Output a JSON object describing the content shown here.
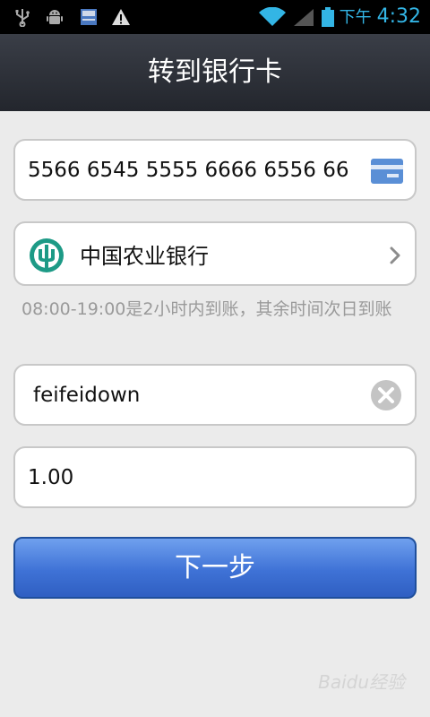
{
  "status_bar": {
    "ampm": "下午",
    "time": "4:32",
    "icons": [
      "usb-icon",
      "android-debug-icon",
      "sd-card-icon",
      "warning-icon",
      "wifi-icon",
      "signal-icon",
      "battery-icon"
    ]
  },
  "header": {
    "title": "转到银行卡"
  },
  "card_number": {
    "value": "5566 6545 5555 6666 6556 66",
    "icon": "bank-card-icon"
  },
  "bank": {
    "name": "中国农业银行",
    "logo": "abc-bank-logo-icon",
    "chevron": "chevron-right-icon"
  },
  "arrival_note": "08:00-19:00是2小时内到账，其余时间次日到账",
  "payee_name": {
    "value": "feifeidown",
    "clear_icon": "clear-icon"
  },
  "amount": {
    "value": "1.00"
  },
  "next_button": {
    "label": "下一步"
  },
  "watermark": {
    "text": "Baidu经验"
  },
  "colors": {
    "title_bar": "#2e3139",
    "button": "#4a7fe0",
    "clock": "#33b5e5",
    "bank_logo": "#1d9a86",
    "card_icon": "#5a8fd6"
  }
}
